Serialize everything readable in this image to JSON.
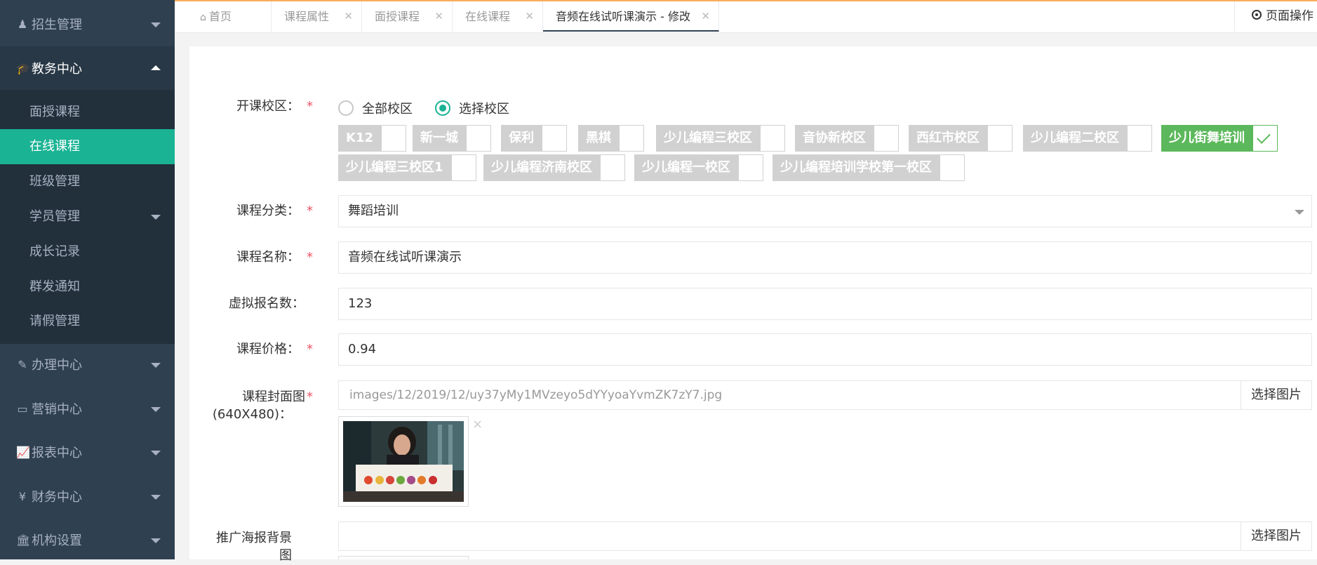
{
  "sidebar": {
    "zhaosheng": "招生管理",
    "jiaowu": "教务中心",
    "sub_items": [
      "面授课程",
      "在线课程",
      "班级管理",
      "学员管理",
      "成长记录",
      "群发通知",
      "请假管理"
    ],
    "banli": "办理中心",
    "yingxiao": "营销中心",
    "baobiao": "报表中心",
    "caiwu": "财务中心",
    "jigou": "机构设置"
  },
  "tabs": [
    "首页",
    "课程属性",
    "面授课程",
    "在线课程",
    "音频在线试听课演示 - 修改"
  ],
  "page_ops": "页面操作",
  "form": {
    "campus_label": "开课校区：",
    "radio_all": "全部校区",
    "radio_select": "选择校区",
    "campuses": [
      "K12",
      "新一城",
      "保利",
      "黑棋",
      "少儿编程三校区",
      "音协新校区",
      "西红市校区",
      "少儿编程二校区",
      "少儿街舞培训",
      "少儿编程三校区1",
      "少儿编程济南校区",
      "少儿编程一校区",
      "少儿编程培训学校第一校区"
    ],
    "category_label": "课程分类：",
    "category_value": "舞蹈培训",
    "name_label": "课程名称：",
    "name_value": "音频在线试听课演示",
    "virtual_label": "虚拟报名数：",
    "virtual_value": "123",
    "price_label": "课程价格：",
    "price_value": "0.94",
    "cover_label_1": "课程封面图",
    "cover_label_2": "(640X480)：",
    "cover_path": "images/12/2019/12/uy37yMy1MVzeyo5dYYyoaYvmZK7zY7.jpg",
    "choose_image": "选择图片",
    "poster_label_1": "推广海报背景",
    "poster_label_2": "图",
    "remove": "×"
  },
  "colors": {
    "sidebar_bg": "#2f4050",
    "active_green": "#1ab394",
    "chip_selected": "#5cb85c",
    "chip_gray": "#d1d1d1",
    "required": "#ed5565"
  }
}
